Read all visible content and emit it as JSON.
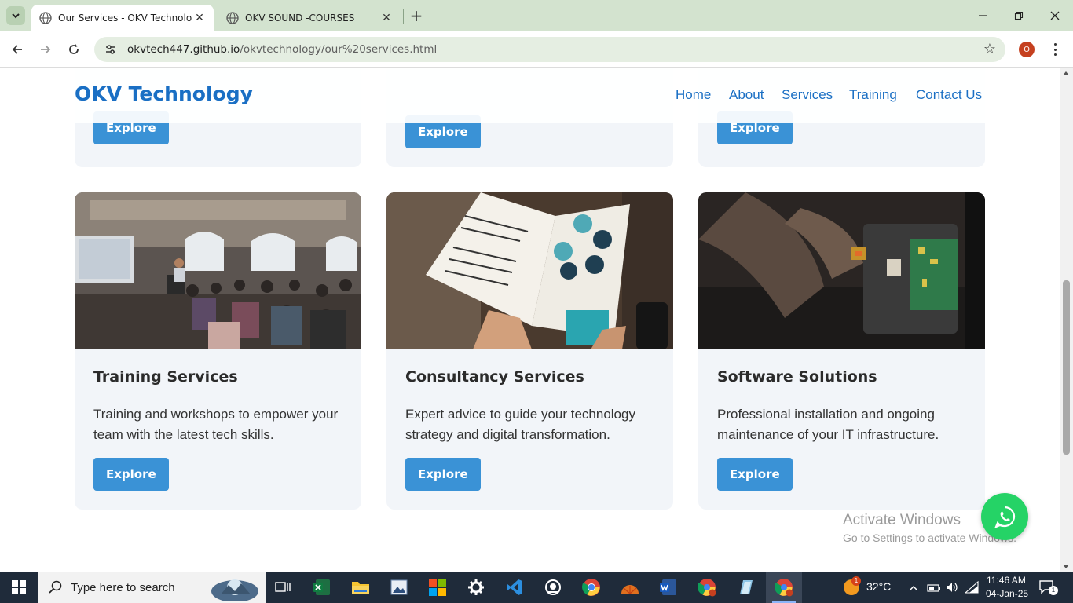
{
  "browser": {
    "tabs": [
      {
        "title": "Our Services - OKV Technology",
        "active": true
      },
      {
        "title": "OKV SOUND -COURSES",
        "active": false
      }
    ],
    "url_host": "okvtech447.github.io",
    "url_path": "/okvtechnology/our%20services.html",
    "profile_initial": "O"
  },
  "site": {
    "logo": "OKV Technology",
    "nav": [
      "Home",
      "About",
      "Services",
      "Training",
      "Contact Us"
    ]
  },
  "services": {
    "top_row_buttons": [
      "Explore",
      "Explore",
      "Explore"
    ],
    "cards": [
      {
        "title": "Training Services",
        "description": "Training and workshops to empower your team with the latest tech skills.",
        "button": "Explore",
        "image": "classroom-training-photo"
      },
      {
        "title": "Consultancy Services",
        "description": "Expert advice to guide your technology strategy and digital transformation.",
        "button": "Explore",
        "image": "consultancy-magazine-photo"
      },
      {
        "title": "Software Solutions",
        "description": "Professional installation and ongoing maintenance of your IT infrastructure.",
        "button": "Explore",
        "image": "hardware-circuit-photo"
      }
    ]
  },
  "watermark": {
    "line1": "Activate Windows",
    "line2": "Go to Settings to activate Windows."
  },
  "taskbar": {
    "search_placeholder": "Type here to search",
    "weather_temp": "32°C",
    "weather_badge": "1",
    "time": "11:46 AM",
    "date": "04-Jan-25",
    "notification_count": "1",
    "apps": [
      "task-view",
      "excel",
      "file-explorer",
      "photos",
      "microsoft-store",
      "settings",
      "vscode",
      "camera",
      "chrome",
      "sun-app",
      "word",
      "chrome-profile",
      "notepad",
      "chrome-active"
    ]
  },
  "colors": {
    "brand_blue": "#1a6fc4",
    "button_blue": "#3a92d6",
    "whatsapp_green": "#25d366",
    "card_bg": "#f2f5f9"
  }
}
